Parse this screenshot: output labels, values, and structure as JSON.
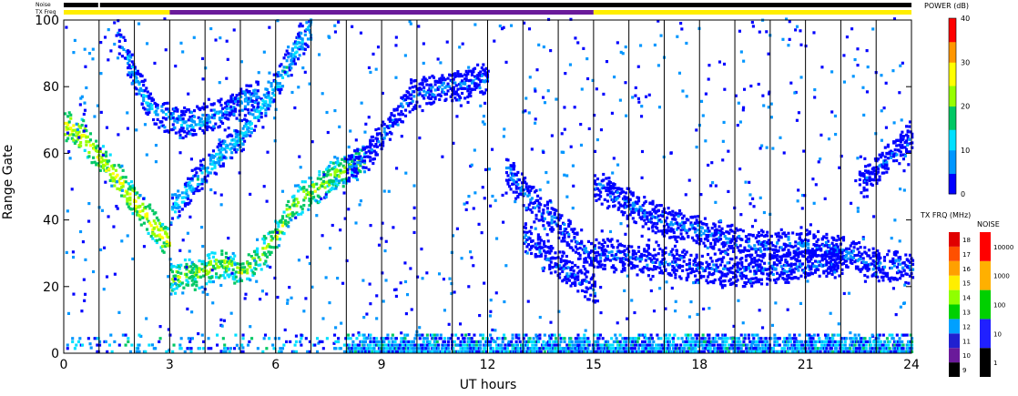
{
  "header": {
    "noise_label": "Noise",
    "txfreq_label": "TX Freq"
  },
  "chart_data": {
    "type": "heatmap",
    "title": "",
    "xlabel": "UT hours",
    "ylabel": "Range Gate",
    "xlim": [
      0,
      24
    ],
    "ylim": [
      0,
      100
    ],
    "x_ticks": [
      0,
      3,
      6,
      9,
      12,
      15,
      18,
      21,
      24
    ],
    "y_ticks": [
      0,
      20,
      40,
      60,
      80,
      100
    ],
    "vertical_scan_markers_hours": [
      1,
      2,
      3,
      4,
      5,
      6,
      7,
      8,
      9,
      10,
      11,
      12,
      13,
      14,
      15,
      16,
      17,
      18,
      19,
      20,
      21,
      22,
      23
    ],
    "noise_bar": {
      "color": "#000000",
      "gap_at_hours": [
        1.0
      ]
    },
    "tx_freq_bar": [
      {
        "from": 0,
        "to": 3,
        "freq_class": "14",
        "color": "#ffee00"
      },
      {
        "from": 3,
        "to": 15,
        "freq_class": "11",
        "color": "#6a1a9a"
      },
      {
        "from": 15,
        "to": 24,
        "freq_class": "14",
        "color": "#ffee00"
      }
    ],
    "echo_bands": [
      {
        "name_hint": "band-a",
        "points": [
          [
            0.0,
            68
          ],
          [
            0.5,
            65
          ],
          [
            1.0,
            58
          ],
          [
            1.5,
            52
          ],
          [
            2.0,
            45
          ],
          [
            2.5,
            38
          ],
          [
            3.0,
            32
          ]
        ],
        "power_db": 26
      },
      {
        "name_hint": "band-b",
        "points": [
          [
            3.0,
            22
          ],
          [
            3.5,
            23
          ],
          [
            4.0,
            24
          ],
          [
            4.5,
            27
          ],
          [
            5.0,
            24
          ],
          [
            5.5,
            28
          ],
          [
            6.0,
            35
          ],
          [
            6.5,
            45
          ],
          [
            7.0,
            48
          ],
          [
            7.5,
            52
          ],
          [
            8.0,
            55
          ],
          [
            8.5,
            58
          ]
        ],
        "power_db": 22
      },
      {
        "name_hint": "band-c",
        "points": [
          [
            3.0,
            42
          ],
          [
            4.0,
            55
          ],
          [
            5.0,
            65
          ],
          [
            6.0,
            80
          ],
          [
            6.5,
            90
          ],
          [
            7.0,
            98
          ]
        ],
        "power_db": 12
      },
      {
        "name_hint": "band-d",
        "points": [
          [
            1.5,
            95
          ],
          [
            2.0,
            82
          ],
          [
            2.5,
            72
          ],
          [
            3.5,
            68
          ],
          [
            4.5,
            72
          ],
          [
            5.5,
            78
          ]
        ],
        "power_db": 9
      },
      {
        "name_hint": "band-e",
        "points": [
          [
            8.0,
            55
          ],
          [
            8.5,
            58
          ],
          [
            9.0,
            65
          ],
          [
            9.5,
            73
          ],
          [
            10.0,
            78
          ],
          [
            11.0,
            80
          ],
          [
            12.0,
            82
          ]
        ],
        "power_db": 6
      },
      {
        "name_hint": "band-f",
        "points": [
          [
            12.5,
            55
          ],
          [
            13.0,
            48
          ],
          [
            13.5,
            42
          ],
          [
            14.0,
            38
          ],
          [
            14.5,
            33
          ],
          [
            15.0,
            28
          ]
        ],
        "power_db": 6
      },
      {
        "name_hint": "band-g",
        "points": [
          [
            13.0,
            35
          ],
          [
            13.5,
            30
          ],
          [
            14.0,
            26
          ],
          [
            14.5,
            22
          ],
          [
            15.0,
            19
          ]
        ],
        "power_db": 5
      },
      {
        "name_hint": "band-h",
        "points": [
          [
            15.0,
            50
          ],
          [
            16.0,
            44
          ],
          [
            17.0,
            39
          ],
          [
            18.0,
            36
          ],
          [
            19.0,
            33
          ],
          [
            20.0,
            32
          ],
          [
            21.0,
            32
          ],
          [
            22.0,
            30
          ],
          [
            23.0,
            26
          ],
          [
            24.0,
            25
          ]
        ],
        "power_db": 6
      },
      {
        "name_hint": "band-i",
        "points": [
          [
            15.0,
            30
          ],
          [
            16.0,
            28
          ],
          [
            17.0,
            27
          ],
          [
            18.0,
            25
          ],
          [
            19.0,
            24
          ],
          [
            20.0,
            25
          ],
          [
            21.0,
            26
          ],
          [
            22.0,
            27
          ]
        ],
        "power_db": 5
      },
      {
        "name_hint": "band-j",
        "points": [
          [
            22.5,
            50
          ],
          [
            23.0,
            55
          ],
          [
            23.5,
            60
          ],
          [
            24.0,
            65
          ]
        ],
        "power_db": 4
      }
    ],
    "ground_scatter_gates": [
      0,
      5
    ],
    "colorbars": {
      "power": {
        "title": "POWER (dB)",
        "ticks": [
          "0",
          "10",
          "20",
          "30",
          "40"
        ],
        "stops": [
          "#0000ff",
          "#0096ff",
          "#00e0ff",
          "#00c864",
          "#96ff00",
          "#ffff00",
          "#ff9600",
          "#ff0000"
        ]
      },
      "tx_freq": {
        "title": "TX FRQ (MHz)",
        "labels": [
          "9",
          "10",
          "11",
          "12",
          "13",
          "14",
          "15",
          "16",
          "17",
          "18"
        ],
        "colors": [
          "#000000",
          "#6a1a9a",
          "#2020d0",
          "#00a0ff",
          "#00d000",
          "#90ff00",
          "#ffee00",
          "#ffa000",
          "#ff5000",
          "#e00000"
        ]
      },
      "noise": {
        "title": "NOISE",
        "labels": [
          "1",
          "10",
          "100",
          "1000",
          "10000"
        ],
        "colors": [
          "#000000",
          "#2020ff",
          "#00d000",
          "#ffb000",
          "#ff0000"
        ]
      }
    }
  }
}
